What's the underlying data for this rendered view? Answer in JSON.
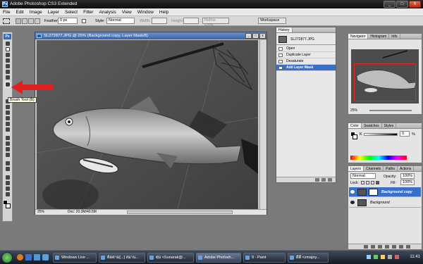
{
  "window": {
    "title": "Adobe Photoshop CS3 Extended",
    "app_icon_text": "Ps",
    "minimize": "_",
    "maximize": "□",
    "close": "X"
  },
  "menu": [
    "File",
    "Edit",
    "Image",
    "Layer",
    "Select",
    "Filter",
    "Analysis",
    "View",
    "Window",
    "Help"
  ],
  "options_bar": {
    "feather_label": "Feather:",
    "feather_value": "0 px",
    "style_label": "Style:",
    "style_value": "Normal",
    "width_label": "Width:",
    "height_label": "Height:",
    "refine_edge": "Refine Edge...",
    "workspace": "Workspace"
  },
  "toolbox": {
    "logo": "Ps",
    "tooltip": "Brush Tool (B)"
  },
  "document": {
    "title": "SL272877.JPG @ 25% (Background copy, Layer Mask/8)",
    "zoom": "25%",
    "doc_size": "Doc: 20.3M/40.5M"
  },
  "history_panel": {
    "tab": "History",
    "snapshot": "SL272877.JPG",
    "items": [
      "Open",
      "Duplicate Layer",
      "Desaturate",
      "Add Layer Mask"
    ],
    "selected_index": 3
  },
  "navigator_panel": {
    "tabs": [
      "Navigator",
      "Histogram",
      "Info"
    ],
    "zoom": "25%"
  },
  "color_panel": {
    "tabs": [
      "Color",
      "Swatches",
      "Styles"
    ],
    "channel_label": "K",
    "channel_value": "0",
    "unit": "%"
  },
  "layers_panel": {
    "tabs": [
      "Layers",
      "Channels",
      "Paths",
      "Actions"
    ],
    "blend_mode": "Normal",
    "opacity_label": "Opacity:",
    "opacity_value": "100%",
    "lock_label": "Lock:",
    "fill_label": "Fill:",
    "fill_value": "100%",
    "layers": [
      {
        "name": "Background copy",
        "selected": true
      },
      {
        "name": "Background",
        "selected": false
      }
    ]
  },
  "taskbar": {
    "buttons": [
      {
        "label": "Windows Live ..."
      },
      {
        "label": "ติดตาม[...] สมาน..."
      },
      {
        "label": "ตุ่ม <Sunarak@..."
      },
      {
        "label": "Adobe Photosh..."
      },
      {
        "label": "9 - Paint"
      },
      {
        "label": "ดีดี <zmajny..."
      }
    ],
    "active_index": 3,
    "clock": "11:41"
  },
  "colors": {
    "accent": "#3a6fc8",
    "arrow": "#e02020",
    "nav_view_box": "#e22222"
  }
}
